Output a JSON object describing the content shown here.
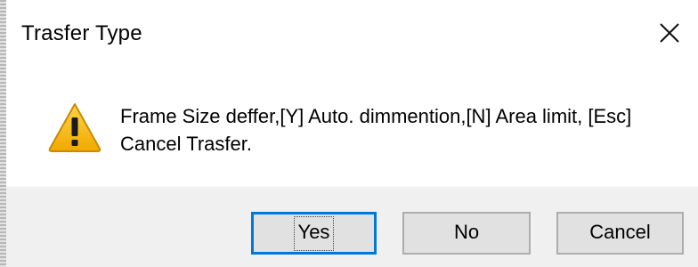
{
  "window": {
    "title": "Trasfer Type"
  },
  "icons": {
    "close": "close-icon",
    "warning": "warning-icon"
  },
  "message": {
    "line1": "Frame Size deffer,[Y] Auto. dimmention,[N] Area limit, [Esc]",
    "line2": "Cancel Trasfer."
  },
  "buttons": {
    "yes": "Yes",
    "no": "No",
    "cancel": "Cancel"
  },
  "colors": {
    "dialog_background": "#ffffff",
    "button_bar_background": "#f0f0f0",
    "button_face": "#e1e1e1",
    "button_border": "#adadad",
    "focus_accent": "#0078d7",
    "warning_fill": "#f4b400"
  }
}
